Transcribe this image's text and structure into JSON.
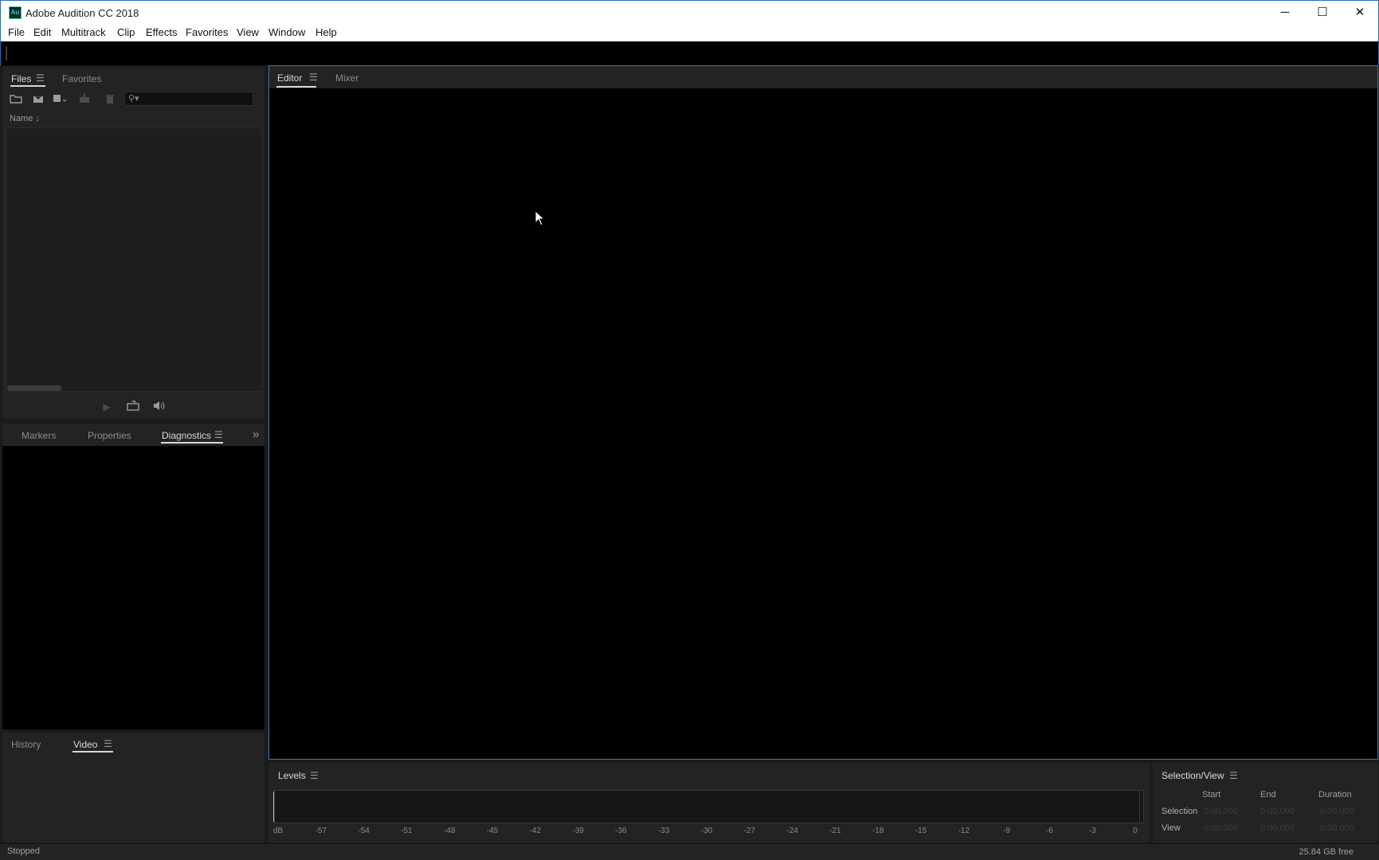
{
  "window": {
    "title": "Adobe Audition CC 2018",
    "app_icon_text": "Au",
    "minimize": "─",
    "maximize": "☐",
    "close": "✕"
  },
  "menu": [
    "File",
    "Edit",
    "Multitrack",
    "Clip",
    "Effects",
    "Favorites",
    "View",
    "Window",
    "Help"
  ],
  "files_panel": {
    "tabs": [
      "Files",
      "Favorites"
    ],
    "active_tab": "Files",
    "search_placeholder": "",
    "column_name": "Name ↓"
  },
  "markers_panel": {
    "tabs": [
      "Markers",
      "Properties",
      "Diagnostics"
    ],
    "active_tab": "Diagnostics",
    "overflow": "»"
  },
  "history_panel": {
    "tabs": [
      "History",
      "Video"
    ],
    "active_tab": "Video"
  },
  "editor_panel": {
    "tabs": [
      "Editor",
      "Mixer"
    ],
    "active_tab": "Editor"
  },
  "levels_panel": {
    "title": "Levels",
    "scale": [
      "dB",
      "-57",
      "-54",
      "-51",
      "-48",
      "-45",
      "-42",
      "-39",
      "-36",
      "-33",
      "-30",
      "-27",
      "-24",
      "-21",
      "-18",
      "-15",
      "-12",
      "-9",
      "-6",
      "-3",
      "0"
    ]
  },
  "selection_view": {
    "title": "Selection/View",
    "columns": [
      "Start",
      "End",
      "Duration"
    ],
    "rows": [
      {
        "label": "Selection",
        "start": "0:00.000",
        "end": "0:00.000",
        "duration": "0:00.000"
      },
      {
        "label": "View",
        "start": "0:00.000",
        "end": "0:00.000",
        "duration": "0:00.000"
      }
    ]
  },
  "status": {
    "left": "Stopped",
    "right": "25.84 GB free"
  },
  "colors": {
    "accent_border": "#3a79b8",
    "panel_bg": "#232323",
    "level_cursor": "#d8c23a"
  }
}
